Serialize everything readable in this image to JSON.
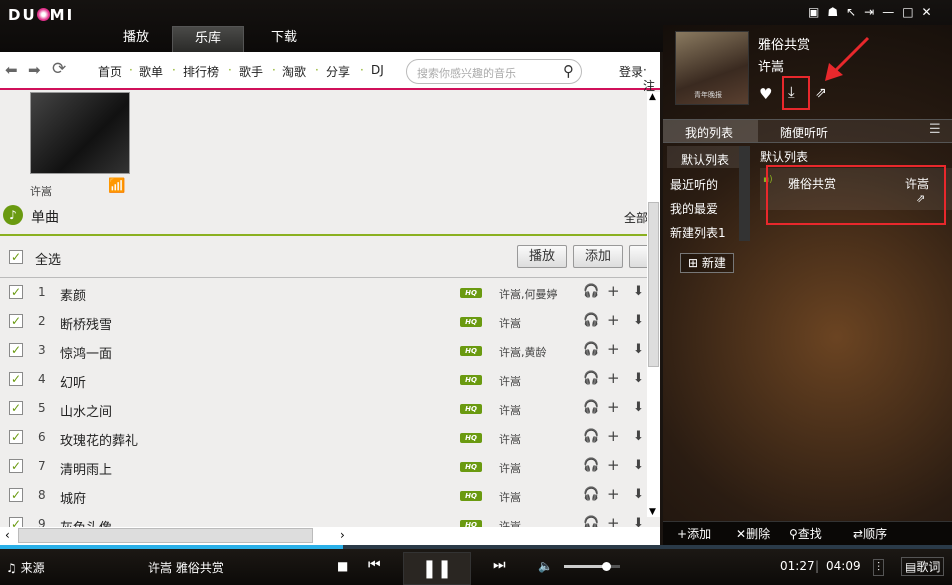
{
  "app": {
    "logo": "DU MI",
    "tabs": [
      "播放",
      "乐库",
      "下载"
    ],
    "active_tab": 1,
    "window_controls": [
      "mini-mode-icon",
      "skin-icon",
      "restore-icon",
      "dock-icon",
      "minimize-icon",
      "maximize-icon",
      "close-icon"
    ]
  },
  "nav": {
    "items": [
      "首页",
      "歌单",
      "排行榜",
      "歌手",
      "淘歌",
      "分享",
      "DJ"
    ],
    "search_placeholder": "搜索你感兴趣的音乐",
    "login": "登录",
    "login_tail": "· 注"
  },
  "artist": {
    "name": "许嵩"
  },
  "section": {
    "title": "单曲",
    "all": "全部"
  },
  "toolbar": {
    "select_all": "全选",
    "play": "播放",
    "add": "添加",
    "download": "下"
  },
  "songs": [
    {
      "n": "1",
      "name": "素颜",
      "singer": "许嵩,何曼婷"
    },
    {
      "n": "2",
      "name": "断桥残雪",
      "singer": "许嵩"
    },
    {
      "n": "3",
      "name": "惊鸿一面",
      "singer": "许嵩,黄龄"
    },
    {
      "n": "4",
      "name": "幻听",
      "singer": "许嵩"
    },
    {
      "n": "5",
      "name": "山水之间",
      "singer": "许嵩"
    },
    {
      "n": "6",
      "name": "玫瑰花的葬礼",
      "singer": "许嵩"
    },
    {
      "n": "7",
      "name": "清明雨上",
      "singer": "许嵩"
    },
    {
      "n": "8",
      "name": "城府",
      "singer": "许嵩"
    },
    {
      "n": "9",
      "name": "灰色头像",
      "singer": "许嵩"
    }
  ],
  "hq_label": "HQ",
  "now": {
    "title": "雅俗共赏",
    "artist": "许嵩",
    "album_text": "青年晚报"
  },
  "playlist_tabs": {
    "mine": "我的列表",
    "random": "随便听听"
  },
  "lists": [
    "默认列表",
    "最近听的",
    "我的最爱",
    "新建列表1"
  ],
  "new_list": "新建",
  "current_list": {
    "title": "默认列表",
    "items": [
      {
        "title": "雅俗共赏",
        "artist": "许嵩"
      }
    ]
  },
  "list_actions": [
    "添加",
    "删除",
    "查找",
    "顺序"
  ],
  "player": {
    "source": "来源",
    "track": "许嵩 雅俗共赏",
    "elapsed": "01:27",
    "total": "04:09",
    "lyrics": "歌词",
    "progress": 0.36,
    "volume": 0.75
  },
  "colors": {
    "accent": "#d0105a",
    "green": "#6a9a10",
    "highlight": "#e8282c"
  }
}
